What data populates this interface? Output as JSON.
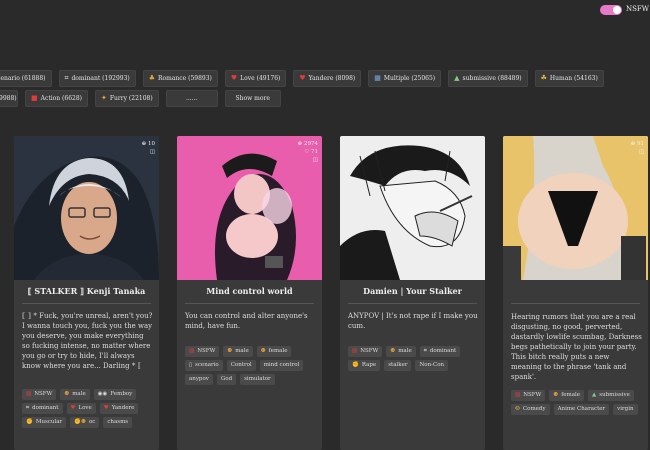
{
  "nsfw_toggle": {
    "label": "NSFW",
    "on": true
  },
  "tag_row_1": [
    {
      "icon": "",
      "label": "scenario (61888)"
    },
    {
      "icon": "⌗",
      "label": "dominant (192993)"
    },
    {
      "icon": "♣",
      "label": "Romance (59893)"
    },
    {
      "icon": "♥",
      "label": "Love (49176)"
    },
    {
      "icon": "♥",
      "label": "Yandere (8098)"
    },
    {
      "icon": "▦",
      "label": "Multiple (25065)"
    },
    {
      "icon": "▲",
      "label": "submissive (88489)"
    },
    {
      "icon": "☘",
      "label": "Human (54163)"
    }
  ],
  "tag_row_2": [
    {
      "icon": "",
      "label": "9988)"
    },
    {
      "icon": "■",
      "label": "Action (6628)"
    },
    {
      "icon": "✦",
      "label": "Furry (22108)"
    },
    {
      "icon": "",
      "label": "......"
    },
    {
      "icon": "",
      "label": "Show more"
    }
  ],
  "cards": [
    {
      "title": "⟦ STALKER ⟧ Kenji Tanaka",
      "stats": [
        "⊕ 10",
        "◫"
      ],
      "desc": "⟦ ⟧ * Fuck, you're unreal, aren't you? I wanna touch you, fuck you the way you deserve, you make everything so fucking intense, no matter where you go or try to hide, I'll always know where you are... Darling * ⟦",
      "tags": [
        {
          "icon": "▨",
          "label": "NSFW"
        },
        {
          "icon": "☻",
          "label": "male"
        },
        {
          "icon": "◉◉",
          "label": "Femboy"
        },
        {
          "icon": "⌗",
          "label": "dominant"
        },
        {
          "icon": "♥",
          "label": "Love"
        },
        {
          "icon": "♥",
          "label": "Yandere"
        },
        {
          "icon": "✊",
          "label": "Muscular"
        },
        {
          "icon": "✊☻",
          "label": "oc"
        },
        {
          "icon": "",
          "label": "chasms"
        }
      ]
    },
    {
      "title": "Mind control world",
      "stats": [
        "⊕ 2974",
        "♡ 71",
        "◫"
      ],
      "desc": "You can control and alter anyone's mind, have fun.",
      "tags": [
        {
          "icon": "▨",
          "label": "NSFW"
        },
        {
          "icon": "☻",
          "label": "male"
        },
        {
          "icon": "☻",
          "label": "female"
        },
        {
          "icon": "▯",
          "label": "scenario"
        },
        {
          "icon": "",
          "label": "Control"
        },
        {
          "icon": "",
          "label": "mind control"
        },
        {
          "icon": "",
          "label": "anypov"
        },
        {
          "icon": "",
          "label": "God"
        },
        {
          "icon": "",
          "label": "simulator"
        }
      ]
    },
    {
      "title": "Damien | Your Stalker",
      "stats": [
        "⊕ 40",
        "◫"
      ],
      "desc": "ANYPOV | It's not rape if I make you cum.",
      "tags": [
        {
          "icon": "▨",
          "label": "NSFW"
        },
        {
          "icon": "☻",
          "label": "male"
        },
        {
          "icon": "⌗",
          "label": "dominant"
        },
        {
          "icon": "✊",
          "label": "Rape"
        },
        {
          "icon": "",
          "label": "stalker"
        },
        {
          "icon": "",
          "label": "Non-Con"
        }
      ]
    },
    {
      "title": "",
      "stats": [
        "⊕ 91",
        "◫"
      ],
      "desc": "Hearing rumors that you are a real disgusting, no good, perverted, dastardly lowlife scumbag, Darkness begs pathetically to join your party. This bitch really puts a new meaning to the phrase 'tank and spank'.",
      "tags": [
        {
          "icon": "▨",
          "label": "NSFW"
        },
        {
          "icon": "☻",
          "label": "female"
        },
        {
          "icon": "▲",
          "label": "submissive"
        },
        {
          "icon": "☺",
          "label": "Comedy"
        },
        {
          "icon": "",
          "label": "Anime Character"
        },
        {
          "icon": "",
          "label": "virgin"
        }
      ]
    }
  ]
}
